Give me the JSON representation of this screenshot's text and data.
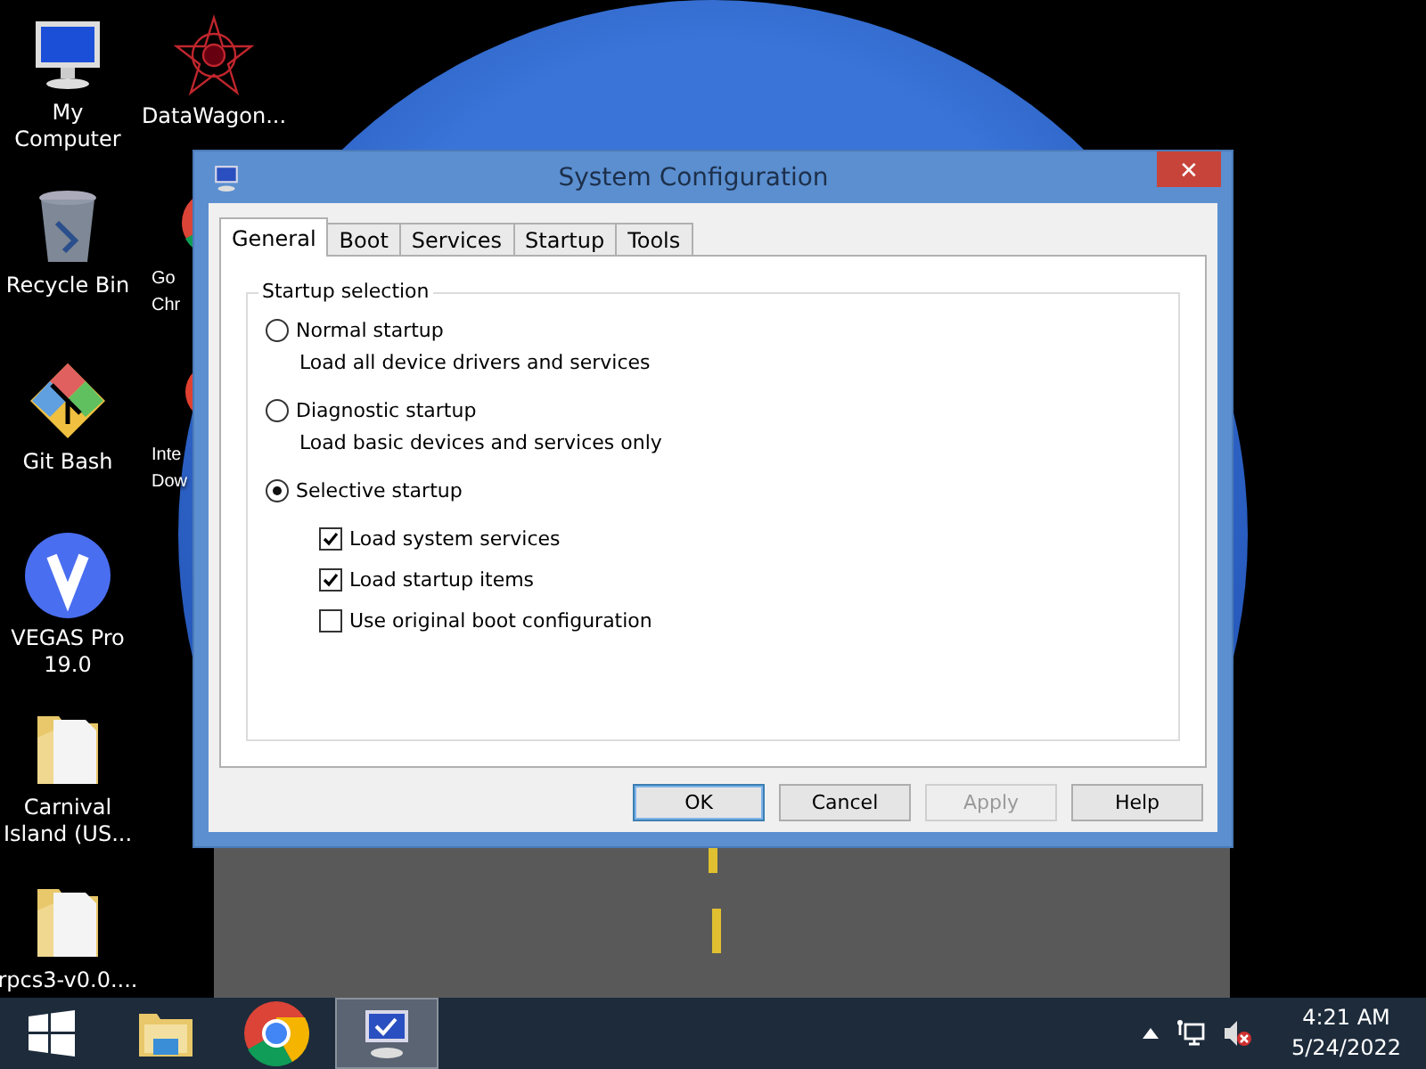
{
  "desktop_icons": [
    {
      "kind": "computer",
      "lines": [
        "My",
        "Computer"
      ]
    },
    {
      "kind": "star",
      "lines": [
        "DataWagon..."
      ]
    },
    {
      "kind": "bin",
      "lines": [
        "Recycle Bin"
      ]
    },
    {
      "kind": "chrome",
      "lines": [
        "Go",
        "Chr"
      ]
    },
    {
      "kind": "git",
      "lines": [
        "Git Bash"
      ]
    },
    {
      "kind": "idm",
      "lines": [
        "Inte",
        "Dow"
      ]
    },
    {
      "kind": "vegas",
      "lines": [
        "VEGAS Pro",
        "19.0"
      ]
    },
    {
      "kind": "folder",
      "lines": [
        "Carnival",
        "Island (US..."
      ]
    },
    {
      "kind": "folder",
      "lines": [
        "rpcs3-v0.0...."
      ]
    }
  ],
  "close_glyph": "✕",
  "window": {
    "title": "System Configuration",
    "tabs": [
      {
        "label": "General",
        "selected": true
      },
      {
        "label": "Boot",
        "selected": false
      },
      {
        "label": "Services",
        "selected": false
      },
      {
        "label": "Startup",
        "selected": false
      },
      {
        "label": "Tools",
        "selected": false
      }
    ],
    "group_title": "Startup selection",
    "options": [
      {
        "kind": "radio",
        "label": "Normal startup",
        "selected": false,
        "description": "Load all device drivers and services"
      },
      {
        "kind": "radio",
        "label": "Diagnostic startup",
        "selected": false,
        "description": "Load basic devices and services only"
      },
      {
        "kind": "radio",
        "label": "Selective startup",
        "selected": true
      },
      {
        "kind": "checkbox",
        "label": "Load system services",
        "checked": true
      },
      {
        "kind": "checkbox",
        "label": "Load startup items",
        "checked": true
      },
      {
        "kind": "checkbox",
        "label": "Use original boot configuration",
        "checked": false
      }
    ],
    "buttons": [
      {
        "label": "OK",
        "default": true,
        "disabled": false
      },
      {
        "label": "Cancel",
        "default": false,
        "disabled": false
      },
      {
        "label": "Apply",
        "default": false,
        "disabled": true
      },
      {
        "label": "Help",
        "default": false,
        "disabled": false
      }
    ]
  },
  "taskbar": {
    "apps": [
      {
        "kind": "explorer",
        "selected": false
      },
      {
        "kind": "chrome",
        "selected": false
      },
      {
        "kind": "msconfig",
        "selected": true
      }
    ],
    "time": "4:21 AM",
    "date": "5/24/2022"
  }
}
